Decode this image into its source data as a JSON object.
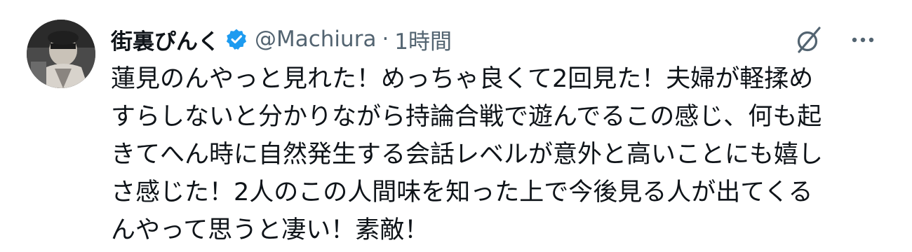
{
  "tweet": {
    "display_name": "街裏ぴんく",
    "handle": "@Machiura",
    "separator": "·",
    "time": "1時間",
    "verified_icon": "verified-badge-icon",
    "actions": {
      "grok_icon": "grok-icon",
      "more_icon": "more-options-icon"
    },
    "text_lines": [
      "蓮見のんやっと見れた！めっちゃ良くて2回見た！夫婦が軽揉め",
      "すらしないと分かりながら持論合戦で遊んでるこの感じ、何も起",
      "きてへん時に自然発生する会話レベルが意外と高いことにも嬉し",
      "さ感じた！2人のこの人間味を知った上で今後見る人が出てくる",
      "んやって思うと凄い！素敵！"
    ]
  },
  "colors": {
    "text_primary": "#0f1419",
    "text_secondary": "#536471",
    "verified_blue": "#1d9bf0"
  }
}
